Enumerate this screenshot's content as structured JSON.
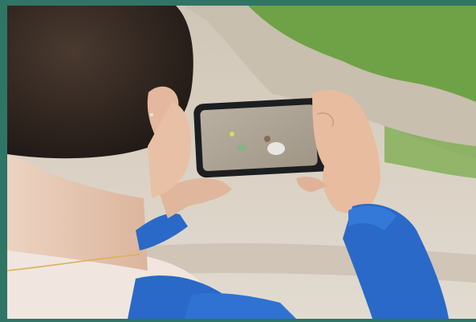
{
  "colors": {
    "border": "#2f7566",
    "sky_hill": "#b9b7ad",
    "grass": "#5f9a3e",
    "sand": "#d8d2c8",
    "hair": "#2b211c",
    "skin": "#e6c0a8",
    "jacket": "#2a69c8",
    "phone_body": "#1d1e22"
  },
  "icons": {
    "scene": "person-photographing-beach-litter-with-phone"
  }
}
